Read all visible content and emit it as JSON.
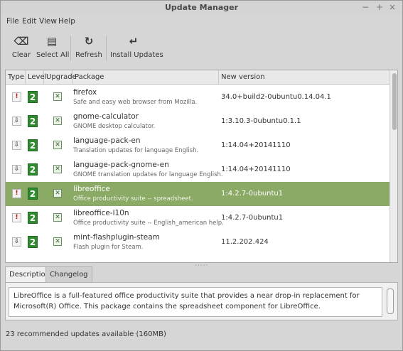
{
  "window": {
    "title": "Update Manager",
    "minimize": "−",
    "maximize": "+",
    "close": "×"
  },
  "menu": [
    "File",
    "Edit",
    "View",
    "Help"
  ],
  "toolbar": {
    "clear": {
      "icon": "⌫",
      "label": "Clear"
    },
    "select_all": {
      "icon": "▤",
      "label": "Select All"
    },
    "refresh": {
      "icon": "↻",
      "label": "Refresh"
    },
    "install": {
      "icon": "↵",
      "label": "Install Updates"
    }
  },
  "columns": [
    "Type",
    "Level",
    "Upgrade",
    "Package",
    "New version"
  ],
  "rows": [
    {
      "type_icon": "!",
      "type": "security",
      "level": "2",
      "upgrade": "✕",
      "name": "firefox",
      "desc": "Safe and easy web browser from Mozilla.",
      "version": "34.0+build2-0ubuntu0.14.04.1",
      "selected": false
    },
    {
      "type_icon": "⇩",
      "type": "update",
      "level": "2",
      "upgrade": "✕",
      "name": "gnome-calculator",
      "desc": "GNOME desktop calculator.",
      "version": "1:3.10.3-0ubuntu0.1.1",
      "selected": false
    },
    {
      "type_icon": "⇩",
      "type": "update",
      "level": "2",
      "upgrade": "✕",
      "name": "language-pack-en",
      "desc": "Translation updates for language English.",
      "version": "1:14.04+20141110",
      "selected": false
    },
    {
      "type_icon": "⇩",
      "type": "update",
      "level": "2",
      "upgrade": "✕",
      "name": "language-pack-gnome-en",
      "desc": "GNOME translation updates for language English.",
      "version": "1:14.04+20141110",
      "selected": false
    },
    {
      "type_icon": "!",
      "type": "security",
      "level": "2",
      "upgrade": "✕",
      "name": "libreoffice",
      "desc": "Office productivity suite -- spreadsheet.",
      "version": "1:4.2.7-0ubuntu1",
      "selected": true
    },
    {
      "type_icon": "!",
      "type": "security",
      "level": "2",
      "upgrade": "✕",
      "name": "libreoffice-l10n",
      "desc": "Office productivity suite -- English_american help.",
      "version": "1:4.2.7-0ubuntu1",
      "selected": false
    },
    {
      "type_icon": "⇩",
      "type": "update",
      "level": "2",
      "upgrade": "✕",
      "name": "mint-flashplugin-steam",
      "desc": "Flash plugin for Steam.",
      "version": "11.2.202.424",
      "selected": false
    }
  ],
  "grip": "·····",
  "tabs": [
    "Description",
    "Changelog"
  ],
  "description": "LibreOffice is a full-featured office productivity suite that provides a near drop-in replacement for Microsoft(R) Office. This package contains the spreadsheet component for LibreOffice.",
  "status": "23 recommended updates available (160MB)",
  "colors": {
    "selected_row": "#8aaa66",
    "level_badge": "#2f8a2f",
    "security_icon": "#cc1111"
  }
}
